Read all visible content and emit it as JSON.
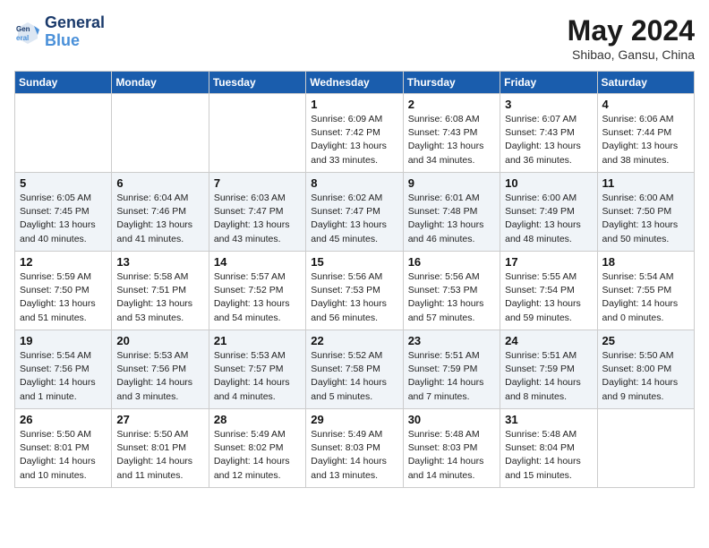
{
  "header": {
    "logo_line1": "General",
    "logo_line2": "Blue",
    "month": "May 2024",
    "location": "Shibao, Gansu, China"
  },
  "weekdays": [
    "Sunday",
    "Monday",
    "Tuesday",
    "Wednesday",
    "Thursday",
    "Friday",
    "Saturday"
  ],
  "weeks": [
    [
      {
        "day": "",
        "info": ""
      },
      {
        "day": "",
        "info": ""
      },
      {
        "day": "",
        "info": ""
      },
      {
        "day": "1",
        "info": "Sunrise: 6:09 AM\nSunset: 7:42 PM\nDaylight: 13 hours\nand 33 minutes."
      },
      {
        "day": "2",
        "info": "Sunrise: 6:08 AM\nSunset: 7:43 PM\nDaylight: 13 hours\nand 34 minutes."
      },
      {
        "day": "3",
        "info": "Sunrise: 6:07 AM\nSunset: 7:43 PM\nDaylight: 13 hours\nand 36 minutes."
      },
      {
        "day": "4",
        "info": "Sunrise: 6:06 AM\nSunset: 7:44 PM\nDaylight: 13 hours\nand 38 minutes."
      }
    ],
    [
      {
        "day": "5",
        "info": "Sunrise: 6:05 AM\nSunset: 7:45 PM\nDaylight: 13 hours\nand 40 minutes."
      },
      {
        "day": "6",
        "info": "Sunrise: 6:04 AM\nSunset: 7:46 PM\nDaylight: 13 hours\nand 41 minutes."
      },
      {
        "day": "7",
        "info": "Sunrise: 6:03 AM\nSunset: 7:47 PM\nDaylight: 13 hours\nand 43 minutes."
      },
      {
        "day": "8",
        "info": "Sunrise: 6:02 AM\nSunset: 7:47 PM\nDaylight: 13 hours\nand 45 minutes."
      },
      {
        "day": "9",
        "info": "Sunrise: 6:01 AM\nSunset: 7:48 PM\nDaylight: 13 hours\nand 46 minutes."
      },
      {
        "day": "10",
        "info": "Sunrise: 6:00 AM\nSunset: 7:49 PM\nDaylight: 13 hours\nand 48 minutes."
      },
      {
        "day": "11",
        "info": "Sunrise: 6:00 AM\nSunset: 7:50 PM\nDaylight: 13 hours\nand 50 minutes."
      }
    ],
    [
      {
        "day": "12",
        "info": "Sunrise: 5:59 AM\nSunset: 7:50 PM\nDaylight: 13 hours\nand 51 minutes."
      },
      {
        "day": "13",
        "info": "Sunrise: 5:58 AM\nSunset: 7:51 PM\nDaylight: 13 hours\nand 53 minutes."
      },
      {
        "day": "14",
        "info": "Sunrise: 5:57 AM\nSunset: 7:52 PM\nDaylight: 13 hours\nand 54 minutes."
      },
      {
        "day": "15",
        "info": "Sunrise: 5:56 AM\nSunset: 7:53 PM\nDaylight: 13 hours\nand 56 minutes."
      },
      {
        "day": "16",
        "info": "Sunrise: 5:56 AM\nSunset: 7:53 PM\nDaylight: 13 hours\nand 57 minutes."
      },
      {
        "day": "17",
        "info": "Sunrise: 5:55 AM\nSunset: 7:54 PM\nDaylight: 13 hours\nand 59 minutes."
      },
      {
        "day": "18",
        "info": "Sunrise: 5:54 AM\nSunset: 7:55 PM\nDaylight: 14 hours\nand 0 minutes."
      }
    ],
    [
      {
        "day": "19",
        "info": "Sunrise: 5:54 AM\nSunset: 7:56 PM\nDaylight: 14 hours\nand 1 minute."
      },
      {
        "day": "20",
        "info": "Sunrise: 5:53 AM\nSunset: 7:56 PM\nDaylight: 14 hours\nand 3 minutes."
      },
      {
        "day": "21",
        "info": "Sunrise: 5:53 AM\nSunset: 7:57 PM\nDaylight: 14 hours\nand 4 minutes."
      },
      {
        "day": "22",
        "info": "Sunrise: 5:52 AM\nSunset: 7:58 PM\nDaylight: 14 hours\nand 5 minutes."
      },
      {
        "day": "23",
        "info": "Sunrise: 5:51 AM\nSunset: 7:59 PM\nDaylight: 14 hours\nand 7 minutes."
      },
      {
        "day": "24",
        "info": "Sunrise: 5:51 AM\nSunset: 7:59 PM\nDaylight: 14 hours\nand 8 minutes."
      },
      {
        "day": "25",
        "info": "Sunrise: 5:50 AM\nSunset: 8:00 PM\nDaylight: 14 hours\nand 9 minutes."
      }
    ],
    [
      {
        "day": "26",
        "info": "Sunrise: 5:50 AM\nSunset: 8:01 PM\nDaylight: 14 hours\nand 10 minutes."
      },
      {
        "day": "27",
        "info": "Sunrise: 5:50 AM\nSunset: 8:01 PM\nDaylight: 14 hours\nand 11 minutes."
      },
      {
        "day": "28",
        "info": "Sunrise: 5:49 AM\nSunset: 8:02 PM\nDaylight: 14 hours\nand 12 minutes."
      },
      {
        "day": "29",
        "info": "Sunrise: 5:49 AM\nSunset: 8:03 PM\nDaylight: 14 hours\nand 13 minutes."
      },
      {
        "day": "30",
        "info": "Sunrise: 5:48 AM\nSunset: 8:03 PM\nDaylight: 14 hours\nand 14 minutes."
      },
      {
        "day": "31",
        "info": "Sunrise: 5:48 AM\nSunset: 8:04 PM\nDaylight: 14 hours\nand 15 minutes."
      },
      {
        "day": "",
        "info": ""
      }
    ]
  ]
}
